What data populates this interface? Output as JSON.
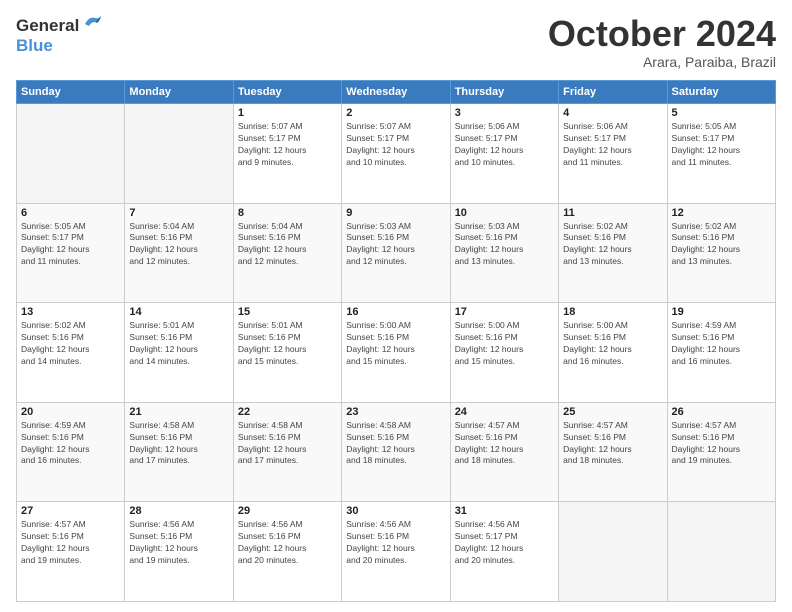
{
  "header": {
    "logo_line1": "General",
    "logo_line2": "Blue",
    "month": "October 2024",
    "location": "Arara, Paraiba, Brazil"
  },
  "days_of_week": [
    "Sunday",
    "Monday",
    "Tuesday",
    "Wednesday",
    "Thursday",
    "Friday",
    "Saturday"
  ],
  "weeks": [
    [
      {
        "day": "",
        "info": ""
      },
      {
        "day": "",
        "info": ""
      },
      {
        "day": "1",
        "info": "Sunrise: 5:07 AM\nSunset: 5:17 PM\nDaylight: 12 hours\nand 9 minutes."
      },
      {
        "day": "2",
        "info": "Sunrise: 5:07 AM\nSunset: 5:17 PM\nDaylight: 12 hours\nand 10 minutes."
      },
      {
        "day": "3",
        "info": "Sunrise: 5:06 AM\nSunset: 5:17 PM\nDaylight: 12 hours\nand 10 minutes."
      },
      {
        "day": "4",
        "info": "Sunrise: 5:06 AM\nSunset: 5:17 PM\nDaylight: 12 hours\nand 11 minutes."
      },
      {
        "day": "5",
        "info": "Sunrise: 5:05 AM\nSunset: 5:17 PM\nDaylight: 12 hours\nand 11 minutes."
      }
    ],
    [
      {
        "day": "6",
        "info": "Sunrise: 5:05 AM\nSunset: 5:17 PM\nDaylight: 12 hours\nand 11 minutes."
      },
      {
        "day": "7",
        "info": "Sunrise: 5:04 AM\nSunset: 5:16 PM\nDaylight: 12 hours\nand 12 minutes."
      },
      {
        "day": "8",
        "info": "Sunrise: 5:04 AM\nSunset: 5:16 PM\nDaylight: 12 hours\nand 12 minutes."
      },
      {
        "day": "9",
        "info": "Sunrise: 5:03 AM\nSunset: 5:16 PM\nDaylight: 12 hours\nand 12 minutes."
      },
      {
        "day": "10",
        "info": "Sunrise: 5:03 AM\nSunset: 5:16 PM\nDaylight: 12 hours\nand 13 minutes."
      },
      {
        "day": "11",
        "info": "Sunrise: 5:02 AM\nSunset: 5:16 PM\nDaylight: 12 hours\nand 13 minutes."
      },
      {
        "day": "12",
        "info": "Sunrise: 5:02 AM\nSunset: 5:16 PM\nDaylight: 12 hours\nand 13 minutes."
      }
    ],
    [
      {
        "day": "13",
        "info": "Sunrise: 5:02 AM\nSunset: 5:16 PM\nDaylight: 12 hours\nand 14 minutes."
      },
      {
        "day": "14",
        "info": "Sunrise: 5:01 AM\nSunset: 5:16 PM\nDaylight: 12 hours\nand 14 minutes."
      },
      {
        "day": "15",
        "info": "Sunrise: 5:01 AM\nSunset: 5:16 PM\nDaylight: 12 hours\nand 15 minutes."
      },
      {
        "day": "16",
        "info": "Sunrise: 5:00 AM\nSunset: 5:16 PM\nDaylight: 12 hours\nand 15 minutes."
      },
      {
        "day": "17",
        "info": "Sunrise: 5:00 AM\nSunset: 5:16 PM\nDaylight: 12 hours\nand 15 minutes."
      },
      {
        "day": "18",
        "info": "Sunrise: 5:00 AM\nSunset: 5:16 PM\nDaylight: 12 hours\nand 16 minutes."
      },
      {
        "day": "19",
        "info": "Sunrise: 4:59 AM\nSunset: 5:16 PM\nDaylight: 12 hours\nand 16 minutes."
      }
    ],
    [
      {
        "day": "20",
        "info": "Sunrise: 4:59 AM\nSunset: 5:16 PM\nDaylight: 12 hours\nand 16 minutes."
      },
      {
        "day": "21",
        "info": "Sunrise: 4:58 AM\nSunset: 5:16 PM\nDaylight: 12 hours\nand 17 minutes."
      },
      {
        "day": "22",
        "info": "Sunrise: 4:58 AM\nSunset: 5:16 PM\nDaylight: 12 hours\nand 17 minutes."
      },
      {
        "day": "23",
        "info": "Sunrise: 4:58 AM\nSunset: 5:16 PM\nDaylight: 12 hours\nand 18 minutes."
      },
      {
        "day": "24",
        "info": "Sunrise: 4:57 AM\nSunset: 5:16 PM\nDaylight: 12 hours\nand 18 minutes."
      },
      {
        "day": "25",
        "info": "Sunrise: 4:57 AM\nSunset: 5:16 PM\nDaylight: 12 hours\nand 18 minutes."
      },
      {
        "day": "26",
        "info": "Sunrise: 4:57 AM\nSunset: 5:16 PM\nDaylight: 12 hours\nand 19 minutes."
      }
    ],
    [
      {
        "day": "27",
        "info": "Sunrise: 4:57 AM\nSunset: 5:16 PM\nDaylight: 12 hours\nand 19 minutes."
      },
      {
        "day": "28",
        "info": "Sunrise: 4:56 AM\nSunset: 5:16 PM\nDaylight: 12 hours\nand 19 minutes."
      },
      {
        "day": "29",
        "info": "Sunrise: 4:56 AM\nSunset: 5:16 PM\nDaylight: 12 hours\nand 20 minutes."
      },
      {
        "day": "30",
        "info": "Sunrise: 4:56 AM\nSunset: 5:16 PM\nDaylight: 12 hours\nand 20 minutes."
      },
      {
        "day": "31",
        "info": "Sunrise: 4:56 AM\nSunset: 5:17 PM\nDaylight: 12 hours\nand 20 minutes."
      },
      {
        "day": "",
        "info": ""
      },
      {
        "day": "",
        "info": ""
      }
    ]
  ]
}
